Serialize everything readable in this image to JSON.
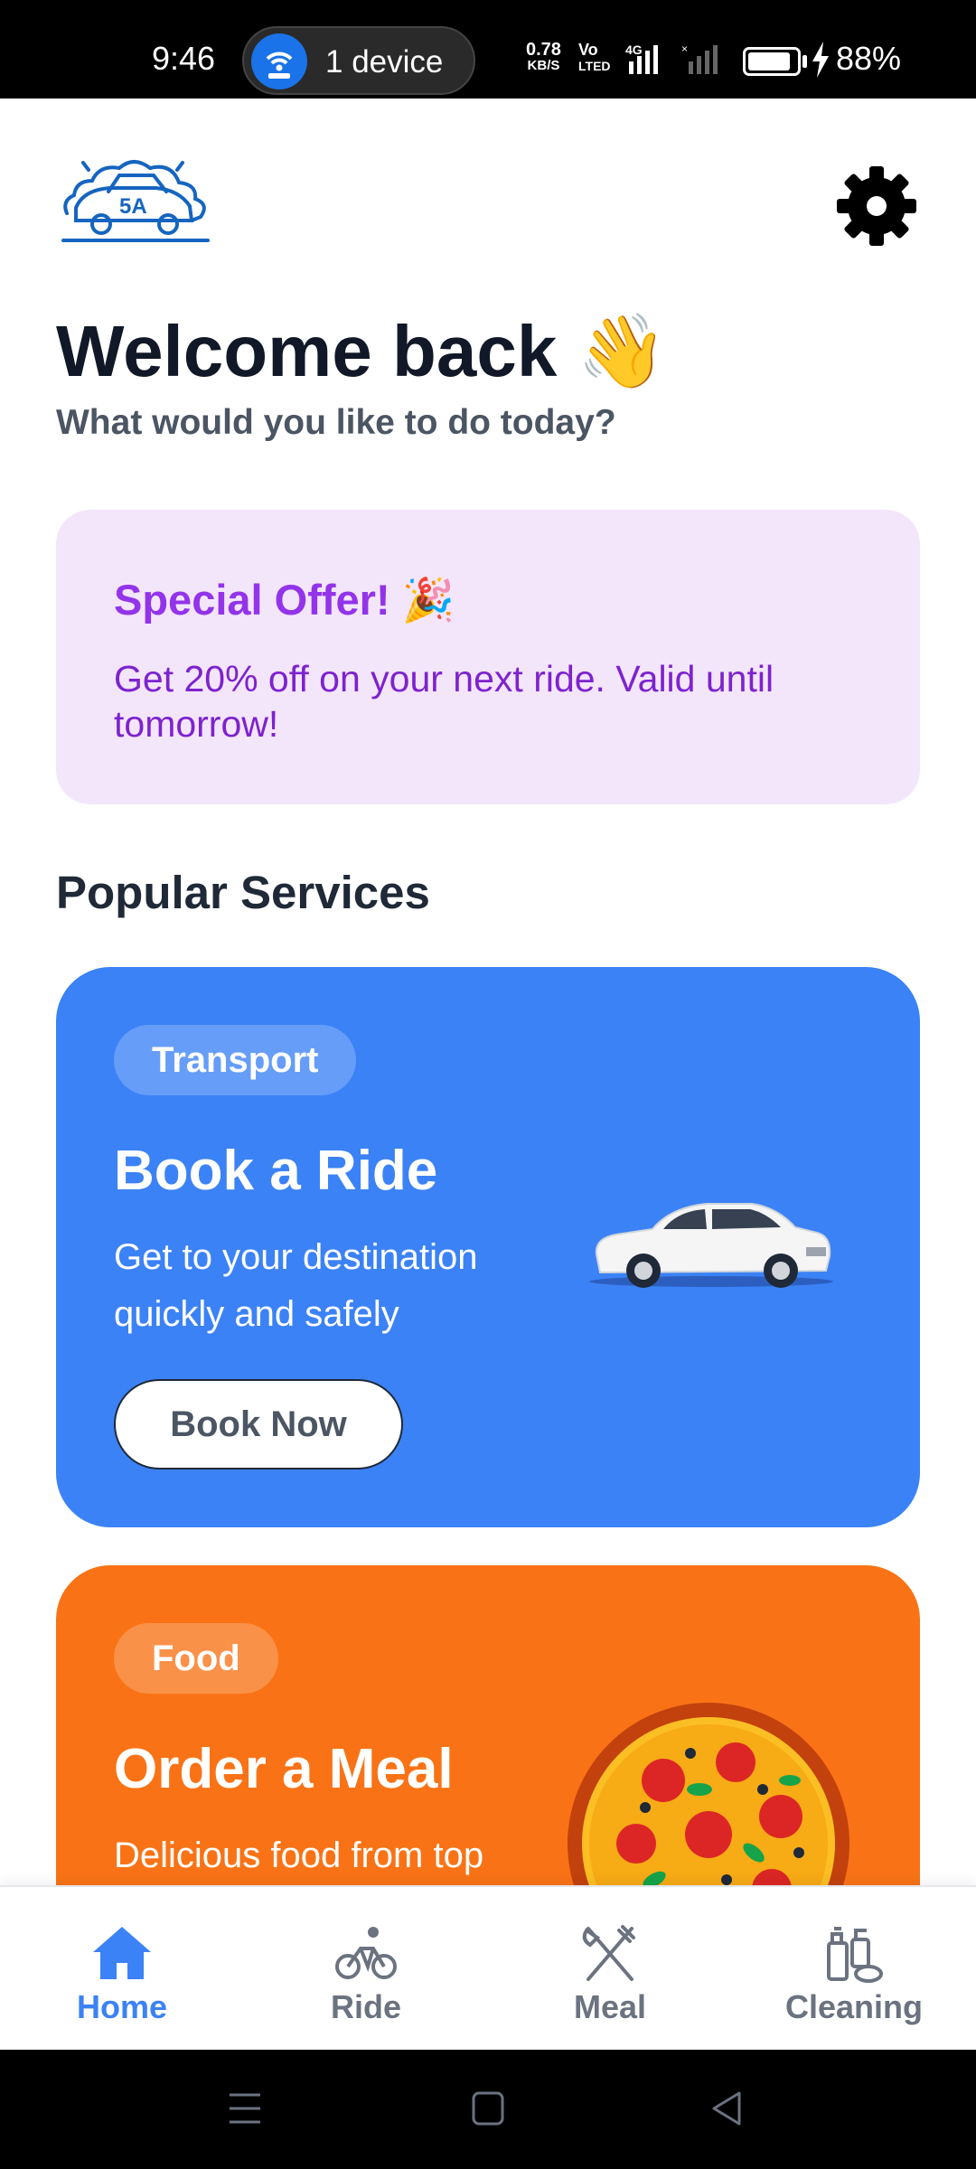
{
  "status_bar": {
    "time": "9:46",
    "hotspot_label": "1 device",
    "net_speed_value": "0.78",
    "net_speed_unit": "KB/S",
    "volte_top": "Vo",
    "volte_bottom": "LTED",
    "network": "4G",
    "battery_percent": "88%",
    "battery_level": 0.88
  },
  "header": {
    "logo_text": "5A",
    "settings_icon": "gear-icon"
  },
  "welcome": {
    "title": "Welcome back 👋",
    "subtitle": "What would you like to do today?"
  },
  "offer": {
    "title": "Special Offer! 🎉",
    "text": "Get 20% off on your next ride. Valid until tomorrow!"
  },
  "section_title": "Popular Services",
  "services": {
    "ride": {
      "chip": "Transport",
      "title": "Book a Ride",
      "description": "Get to your destination quickly and safely",
      "button": "Book Now"
    },
    "meal": {
      "chip": "Food",
      "title": "Order a Meal",
      "description": "Delicious food from top"
    }
  },
  "bottom_nav": [
    {
      "label": "Home",
      "icon": "home-icon",
      "active": true
    },
    {
      "label": "Ride",
      "icon": "bicycle-icon",
      "active": false
    },
    {
      "label": "Meal",
      "icon": "fork-knife-icon",
      "active": false
    },
    {
      "label": "Cleaning",
      "icon": "cleaning-icon",
      "active": false
    }
  ],
  "colors": {
    "ride_card": "#3b82f6",
    "meal_card": "#f97316",
    "offer_bg": "#f3e6fb",
    "offer_accent": "#9333ea",
    "nav_active": "#3b82f6"
  }
}
